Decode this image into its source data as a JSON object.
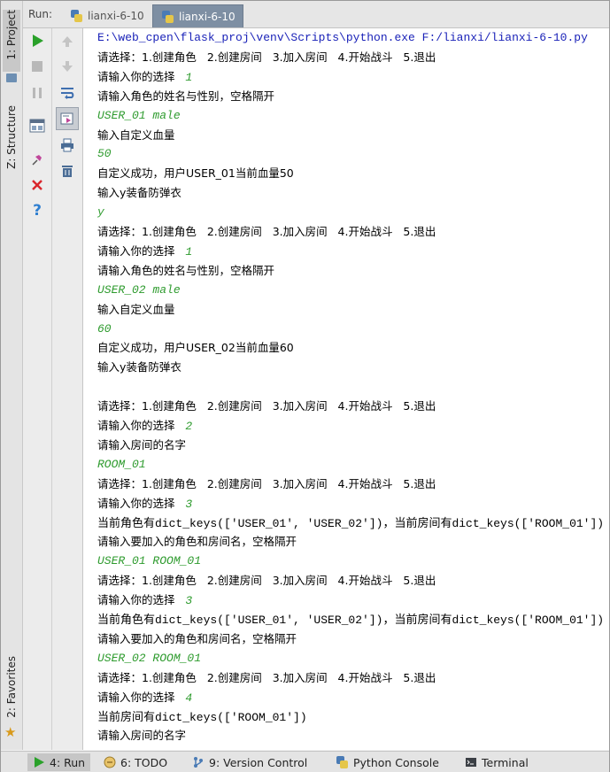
{
  "left_strip": {
    "project_tab": "1: Project",
    "structure_tab": "Z: Structure",
    "favorites_tab": "2: Favorites"
  },
  "run_header": {
    "label": "Run:",
    "tabs": [
      {
        "label": "lianxi-6-10",
        "selected": false
      },
      {
        "label": "lianxi-6-10",
        "selected": true
      }
    ]
  },
  "console": {
    "lines": [
      {
        "kind": "cmd",
        "text": "E:\\web_cpen\\flask_proj\\venv\\Scripts\\python.exe F:/lianxi/lianxi-6-10.py"
      },
      {
        "kind": "out",
        "text": "请选择：1.创建角色   2.创建房间   3.加入房间   4.开始战斗   5.退出"
      },
      {
        "kind": "out",
        "text": "请输入你的选择   ",
        "input": "1"
      },
      {
        "kind": "out",
        "text": "请输入角色的姓名与性别，空格隔开"
      },
      {
        "kind": "inp",
        "text": "USER_01 male"
      },
      {
        "kind": "out",
        "text": "输入自定义血量"
      },
      {
        "kind": "inp",
        "text": "50"
      },
      {
        "kind": "out",
        "text": "自定义成功，用户USER_01当前血量50"
      },
      {
        "kind": "out",
        "text": "输入y装备防弹衣"
      },
      {
        "kind": "inp",
        "text": "y"
      },
      {
        "kind": "out",
        "text": "请选择：1.创建角色   2.创建房间   3.加入房间   4.开始战斗   5.退出"
      },
      {
        "kind": "out",
        "text": "请输入你的选择   ",
        "input": "1"
      },
      {
        "kind": "out",
        "text": "请输入角色的姓名与性别，空格隔开"
      },
      {
        "kind": "inp",
        "text": "USER_02 male"
      },
      {
        "kind": "out",
        "text": "输入自定义血量"
      },
      {
        "kind": "inp",
        "text": "60"
      },
      {
        "kind": "out",
        "text": "自定义成功，用户USER_02当前血量60"
      },
      {
        "kind": "out",
        "text": "输入y装备防弹衣"
      },
      {
        "kind": "blank",
        "text": ""
      },
      {
        "kind": "out",
        "text": "请选择：1.创建角色   2.创建房间   3.加入房间   4.开始战斗   5.退出"
      },
      {
        "kind": "out",
        "text": "请输入你的选择   ",
        "input": "2"
      },
      {
        "kind": "out",
        "text": "请输入房间的名字"
      },
      {
        "kind": "inp",
        "text": "ROOM_01"
      },
      {
        "kind": "out",
        "text": "请选择：1.创建角色   2.创建房间   3.加入房间   4.开始战斗   5.退出"
      },
      {
        "kind": "out",
        "text": "请输入你的选择   ",
        "input": "3"
      },
      {
        "kind": "mono",
        "text": "当前角色有dict_keys(['USER_01', 'USER_02'])，当前房间有dict_keys(['ROOM_01'])"
      },
      {
        "kind": "out",
        "text": "请输入要加入的角色和房间名，空格隔开"
      },
      {
        "kind": "inp",
        "text": "USER_01 ROOM_01"
      },
      {
        "kind": "out",
        "text": "请选择：1.创建角色   2.创建房间   3.加入房间   4.开始战斗   5.退出"
      },
      {
        "kind": "out",
        "text": "请输入你的选择   ",
        "input": "3"
      },
      {
        "kind": "mono",
        "text": "当前角色有dict_keys(['USER_01', 'USER_02'])，当前房间有dict_keys(['ROOM_01'])"
      },
      {
        "kind": "out",
        "text": "请输入要加入的角色和房间名，空格隔开"
      },
      {
        "kind": "inp",
        "text": "USER_02 ROOM_01"
      },
      {
        "kind": "out",
        "text": "请选择：1.创建角色   2.创建房间   3.加入房间   4.开始战斗   5.退出"
      },
      {
        "kind": "out",
        "text": "请输入你的选择   ",
        "input": "4"
      },
      {
        "kind": "mono",
        "text": "当前房间有dict_keys(['ROOM_01'])"
      },
      {
        "kind": "out",
        "text": "请输入房间的名字"
      }
    ]
  },
  "bottom_bar": {
    "tabs": [
      {
        "label": "4: Run",
        "icon": "run-icon",
        "selected": true
      },
      {
        "label": "6: TODO",
        "icon": "todo-icon",
        "selected": false
      },
      {
        "label": "9: Version Control",
        "icon": "version-control-icon",
        "selected": false
      },
      {
        "label": "Python Console",
        "icon": "python-console-icon",
        "selected": false
      },
      {
        "label": "Terminal",
        "icon": "terminal-icon",
        "selected": false
      }
    ]
  },
  "colors": {
    "command": "#1a22b8",
    "user_input": "#2e9b2e",
    "rerun_green": "#2aa12a",
    "close_red": "#d9262c",
    "help_blue": "#2f7fd0"
  }
}
